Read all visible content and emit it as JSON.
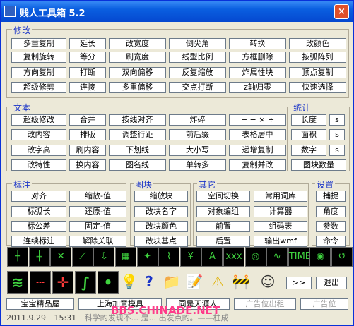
{
  "window": {
    "title": "贱人工具箱 5.2",
    "close_label": "×"
  },
  "groups": {
    "modify": "修改",
    "text": "文本",
    "stats": "统计",
    "dim": "标注",
    "block": "图块",
    "other": "其它",
    "settings": "设置"
  },
  "modify_buttons": [
    "多重复制",
    "延长",
    "改宽度",
    "倒尖角",
    "转换",
    "改颜色",
    "复制旋转",
    "等分",
    "刷宽度",
    "线型比例",
    "方框删除",
    "按弧阵列",
    "方向复制",
    "打断",
    "双向偏移",
    "反复缩放",
    "炸属性块",
    "顶点复制",
    "超级修剪",
    "连接",
    "多重偏移",
    "交点打断",
    "z轴归零",
    "快速选择"
  ],
  "text_buttons": [
    "超级修改",
    "合并",
    "按线对齐",
    "炸碎",
    "+ − × ÷",
    "改内容",
    "排版",
    "调整行距",
    "前后缀",
    "表格居中",
    "改字高",
    "刷内容",
    "下划线",
    "大小写",
    "递增复制",
    "改特性",
    "换内容",
    "图名线",
    "单转多",
    "复制并改"
  ],
  "stats_buttons": [
    "长度",
    "面积",
    "数字",
    "图块数量"
  ],
  "stats_small": [
    "s",
    "s",
    "s"
  ],
  "dim_buttons": [
    "对齐",
    "标弧长",
    "标公差",
    "连续标注"
  ],
  "block_buttons": [
    "缩放-值",
    "缩放块",
    "还原-值",
    "改块名字",
    "固定-值",
    "改块颜色",
    "解除关联",
    "改块基点"
  ],
  "other_buttons": [
    "空间切换",
    "常用词库",
    "对象编组",
    "计算器",
    "前置",
    "组码表",
    "后置",
    "输出wmf"
  ],
  "settings_buttons": [
    "捕捉",
    "角度",
    "参数",
    "命令"
  ],
  "icons_row1": [
    "center-mark-icon",
    "dim-lines-icon",
    "angle-x-icon",
    "line-extend-icon",
    "arrow-down-icon",
    "table-grid-icon",
    "star-icon",
    "break-line-icon",
    "tree-icon",
    "hatch-a-icon",
    "xxx-line-icon",
    "circle-spline-icon",
    "wave-icon",
    "time-text-icon",
    "spiral-icon",
    "curve-arrow-icon"
  ],
  "icons_row2": [
    "zigzag-icon",
    "dashed-line-icon",
    "cross-line-icon",
    "spline-icon",
    "dot-icon",
    "lightbulb-icon",
    "help-icon",
    "folder-icon",
    "notepad-icon",
    "warning-icon",
    "worker-icon",
    "avatar-icon"
  ],
  "more_label": ">>",
  "exit_label": "退出",
  "links": [
    "宝宝精品屋",
    "上海加意模具",
    "同是天涯人",
    "广告位出租",
    "广告位"
  ],
  "status": {
    "date": "2011.9.29",
    "time": "15:31",
    "hint": "科学的发现不... 是... 出发点的。——柱成"
  },
  "watermark": "BBS.CHINADE.NET"
}
